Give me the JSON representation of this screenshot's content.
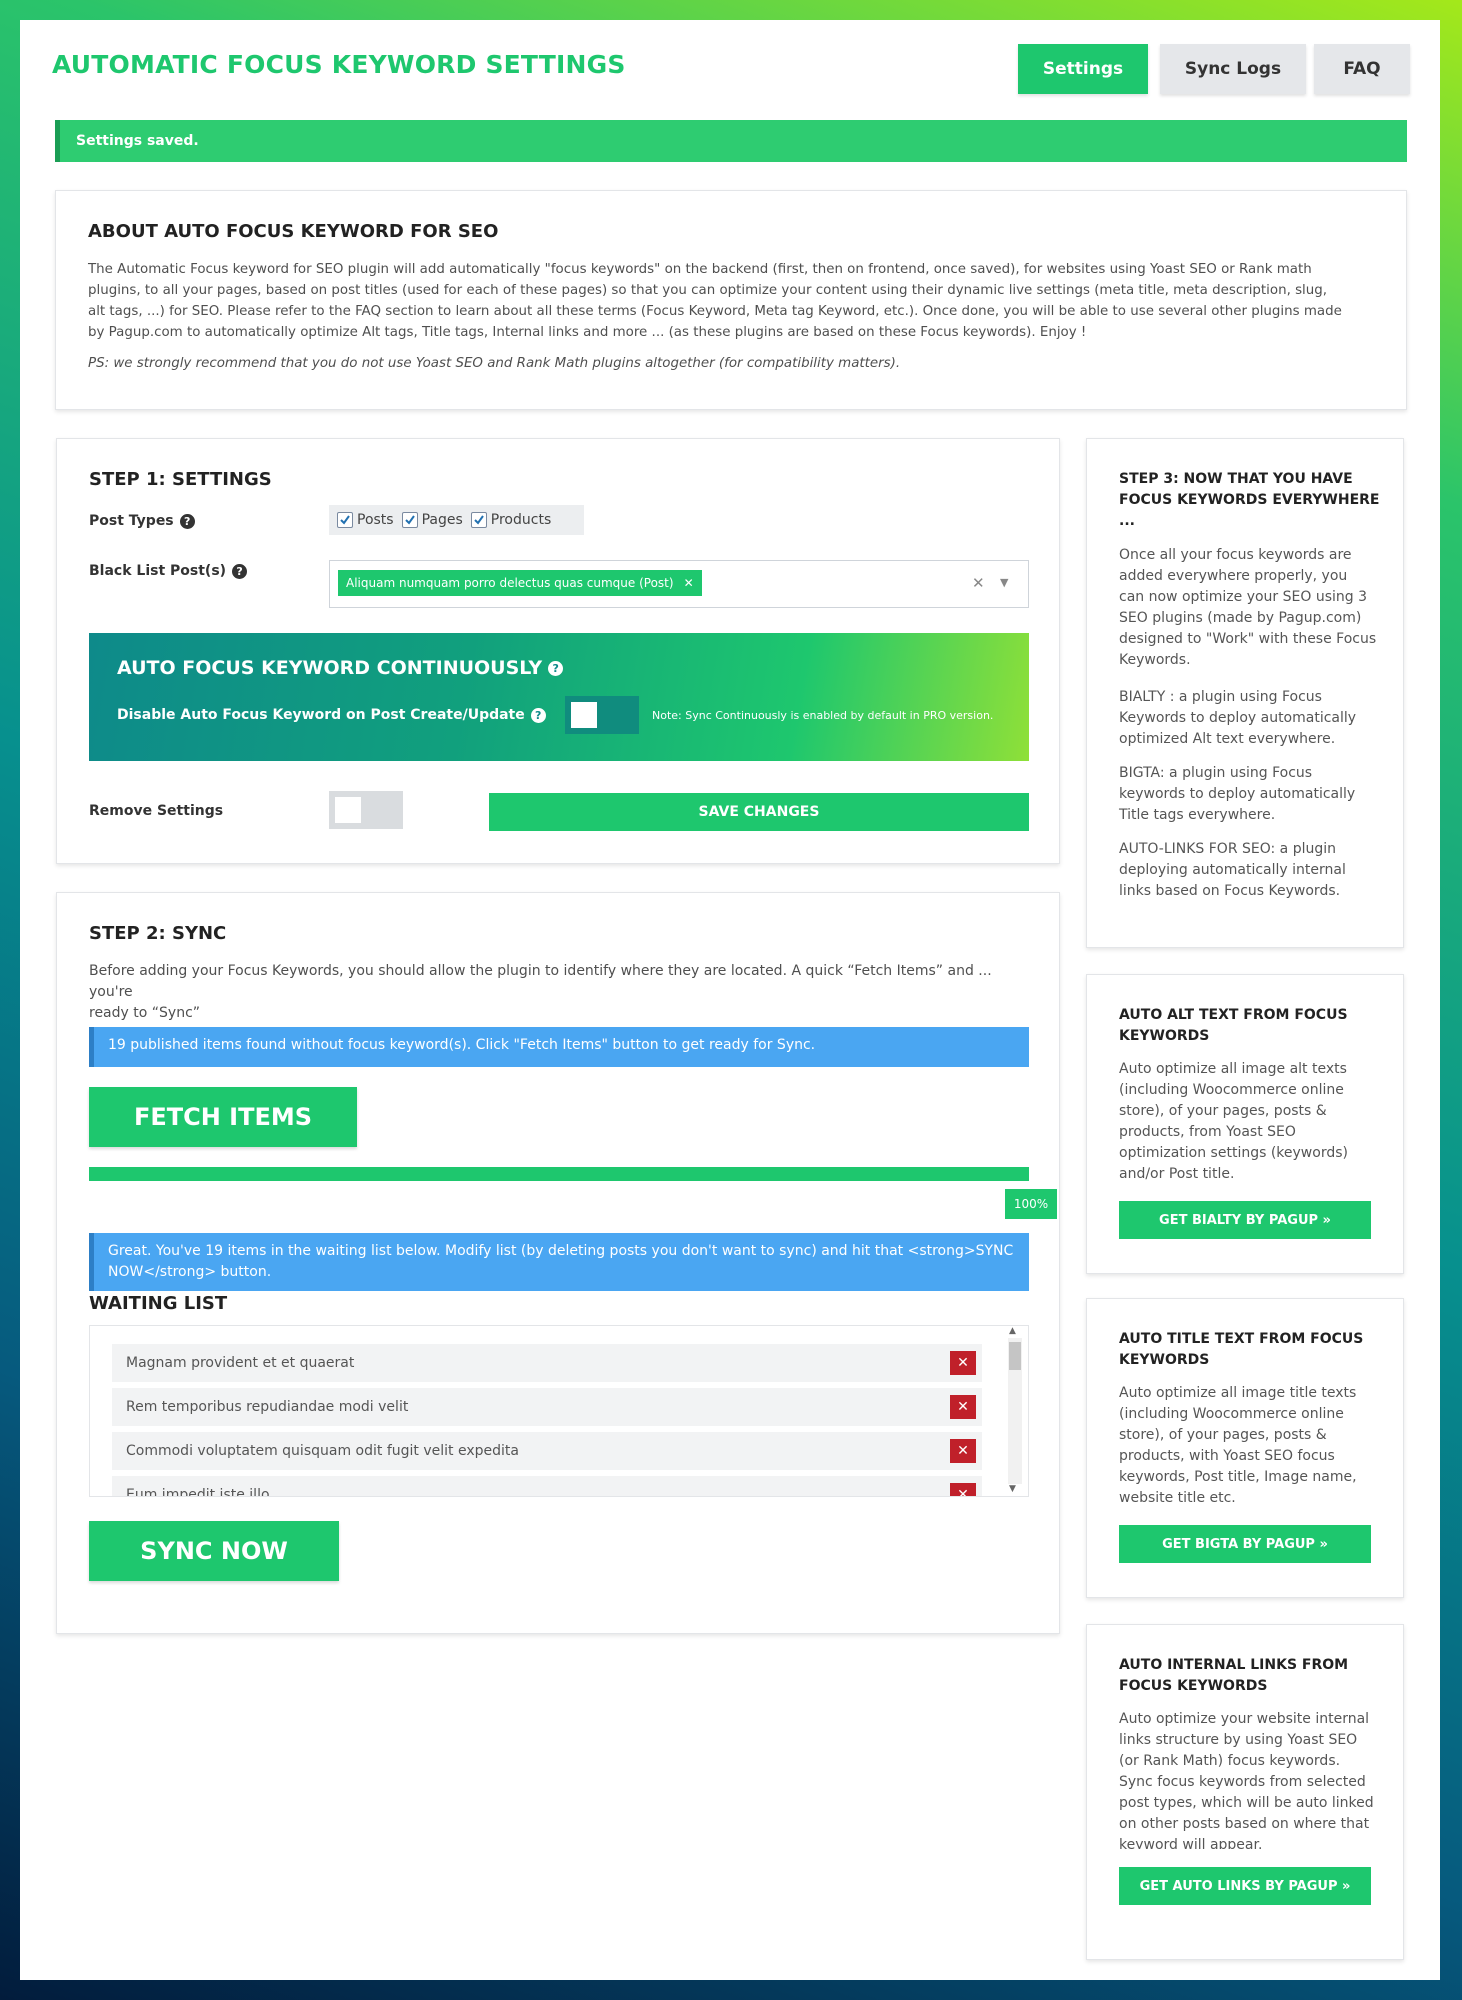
{
  "header": {
    "title": "AUTOMATIC FOCUS KEYWORD SETTINGS",
    "tabs": [
      {
        "label": "Settings",
        "active": true
      },
      {
        "label": "Sync Logs",
        "active": false
      },
      {
        "label": "FAQ",
        "active": false
      }
    ]
  },
  "notice": {
    "text": "Settings saved."
  },
  "about": {
    "title": "ABOUT AUTO FOCUS KEYWORD FOR SEO",
    "lines": [
      "The Automatic Focus keyword for SEO plugin will add automatically \"focus keywords\" on the backend (first, then on frontend, once saved), for websites using Yoast SEO or Rank math",
      "plugins, to all your pages, based on post titles (used for each of these pages) so that you can optimize your content using their dynamic live settings (meta title, meta description, slug,",
      "alt tags, ...) for SEO. Please refer to the FAQ section to learn about all these terms (Focus Keyword, Meta tag Keyword, etc.). Once done, you will be able to use several other plugins made",
      "by Pagup.com to automatically optimize Alt tags, Title tags, Internal links and more ... (as these plugins are based on these Focus keywords). Enjoy !"
    ],
    "ps": "PS: we strongly recommend that you do not use Yoast SEO and Rank Math plugins altogether (for compatibility matters)."
  },
  "step1": {
    "title": "STEP 1: SETTINGS",
    "post_types_label": "Post Types",
    "post_types": [
      {
        "label": "Posts",
        "checked": true
      },
      {
        "label": "Pages",
        "checked": true
      },
      {
        "label": "Products",
        "checked": true
      }
    ],
    "blacklist_label": "Black List Post(s)",
    "blacklist_chip": "Aliquam numquam porro delectus quas cumque (Post)",
    "auto_title": "AUTO FOCUS KEYWORD CONTINUOUSLY",
    "disable_label": "Disable Auto Focus Keyword on Post Create/Update",
    "note": "Note: Sync Continuously is enabled by default in PRO version.",
    "remove_label": "Remove Settings",
    "save_label": "SAVE CHANGES"
  },
  "step2": {
    "title": "STEP 2: SYNC",
    "desc_lines": [
      "Before adding your Focus Keywords, you should allow the plugin to identify where they are located. A quick “Fetch Items” and ... you're",
      "ready to “Sync”"
    ],
    "info1": "19 published items found without focus keyword(s). Click \"Fetch Items\" button to get ready for Sync.",
    "fetch_label": "FETCH ITEMS",
    "progress_value": 1.0,
    "progress_text": "100%",
    "info2_lines": [
      "Great. You've 19 items in the waiting list below. Modify list (by deleting posts you don't want to sync) and hit that <strong>SYNC",
      "NOW</strong> button."
    ],
    "waiting_title": "WAITING LIST",
    "waiting_items": [
      "Magnam provident et et quaerat",
      "Rem temporibus repudiandae modi velit",
      "Commodi voluptatem quisquam odit fugit velit expedita",
      "Eum impedit iste illo"
    ],
    "sync_label": "SYNC NOW"
  },
  "sidebar": {
    "step3": {
      "title_lines": [
        "STEP 3: NOW THAT YOU HAVE",
        "FOCUS KEYWORDS EVERYWHERE",
        "..."
      ],
      "para1": [
        "Once all your focus keywords are",
        "added everywhere properly, you",
        "can now optimize your SEO using 3",
        "SEO plugins (made by Pagup.com)",
        "designed to \"Work\" with these Focus",
        "Keywords."
      ],
      "para2": [
        "BIALTY : a plugin using Focus",
        "Keywords to deploy automatically",
        "optimized Alt text everywhere."
      ],
      "para3": [
        "BIGTA: a plugin using Focus",
        "keywords to deploy automatically",
        "Title tags everywhere."
      ],
      "para4": [
        "AUTO-LINKS FOR SEO: a plugin",
        "deploying automatically internal",
        "links based on Focus Keywords."
      ]
    },
    "alt": {
      "title_lines": [
        "AUTO ALT TEXT FROM FOCUS",
        "KEYWORDS"
      ],
      "text": [
        "Auto optimize all image alt texts",
        "(including Woocommerce online",
        "store), of your pages, posts &",
        "products, from Yoast SEO",
        "optimization settings (keywords)",
        "and/or Post title."
      ],
      "button": "GET BIALTY BY PAGUP »"
    },
    "title_text": {
      "title_lines": [
        "AUTO TITLE TEXT FROM FOCUS",
        "KEYWORDS"
      ],
      "text": [
        "Auto optimize all image title texts",
        "(including Woocommerce online",
        "store), of your pages, posts &",
        "products, with Yoast SEO focus",
        "keywords, Post title, Image name,",
        "website title etc."
      ],
      "button": "GET BIGTA BY PAGUP »"
    },
    "links": {
      "title_lines": [
        "AUTO INTERNAL LINKS FROM",
        "FOCUS KEYWORDS"
      ],
      "text": [
        "Auto optimize your website internal",
        "links structure by using Yoast SEO",
        "(or Rank Math) focus keywords.",
        "Sync focus keywords from selected",
        "post types, which will be auto linked",
        "on other posts based on where that",
        "keyword will appear."
      ],
      "button": "GET AUTO LINKS BY PAGUP »"
    }
  },
  "icons": {
    "help": "question-circle-icon",
    "check": "checkmark-icon",
    "remove": "close-icon",
    "dropdown": "chevron-down-icon"
  },
  "colors": {
    "accent": "#1ec76e",
    "info": "#4aa6f2",
    "danger": "#c0202a"
  }
}
